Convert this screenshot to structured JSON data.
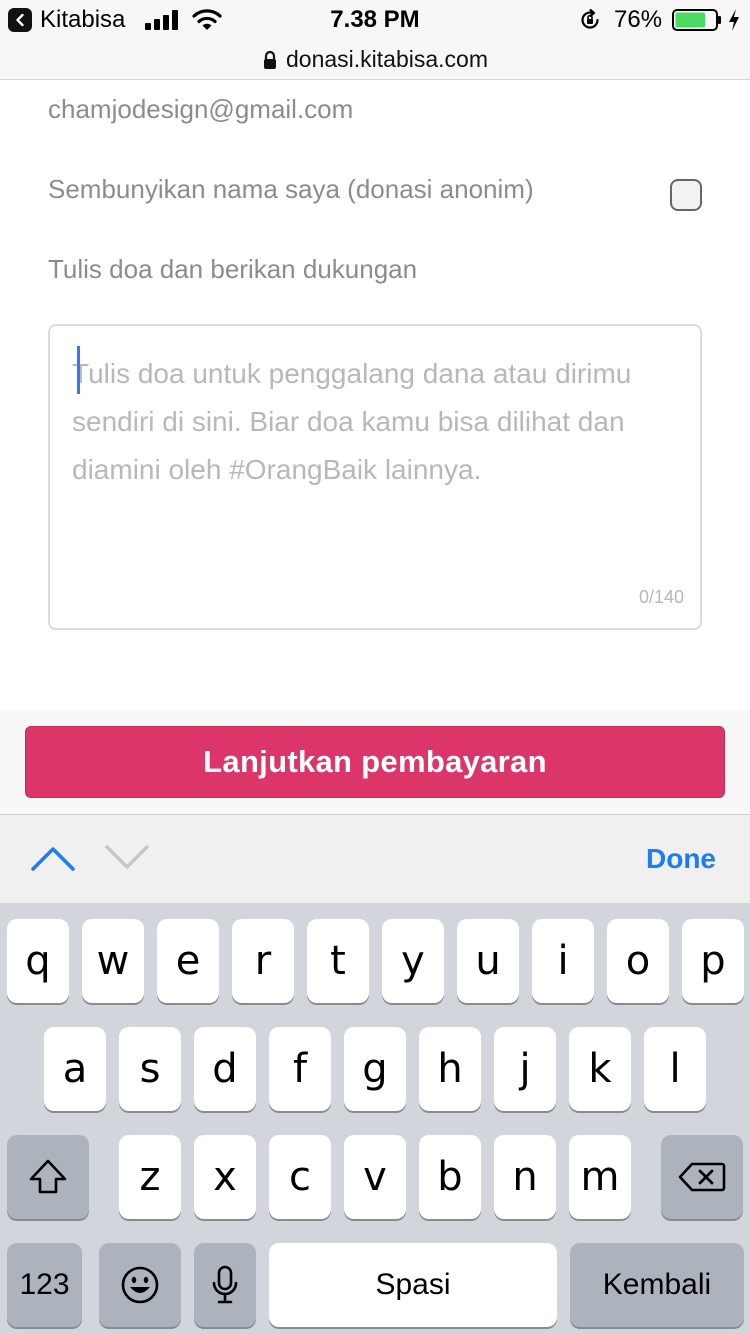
{
  "status_bar": {
    "back_app": "Kitabisa",
    "time": "7.38 PM",
    "battery_percent": "76%",
    "battery_level": 0.76
  },
  "url_bar": {
    "domain": "donasi.kitabisa.com"
  },
  "form": {
    "email": "chamjodesign@gmail.com",
    "anonymous_label": "Sembunyikan nama saya (donasi anonim)",
    "anonymous_checked": false,
    "prayer_label": "Tulis doa dan berikan dukungan",
    "prayer_placeholder": "Tulis doa untuk penggalang dana atau dirimu sendiri di sini. Biar doa kamu bisa dilihat dan diamini oleh #OrangBaik lainnya.",
    "char_counter": "0/140"
  },
  "cta": {
    "label": "Lanjutkan pembayaran",
    "color": "#dc3569"
  },
  "accessory": {
    "done_label": "Done",
    "accent": "#1b7cf4"
  },
  "keyboard": {
    "row1": [
      "q",
      "w",
      "e",
      "r",
      "t",
      "y",
      "u",
      "i",
      "o",
      "p"
    ],
    "row2": [
      "a",
      "s",
      "d",
      "f",
      "g",
      "h",
      "j",
      "k",
      "l"
    ],
    "row3": [
      "z",
      "x",
      "c",
      "v",
      "b",
      "n",
      "m"
    ],
    "numbers_label": "123",
    "space_label": "Spasi",
    "return_label": "Kembali",
    "icons": {
      "shift": "shift-icon",
      "delete": "backspace-icon",
      "emoji": "emoji-icon",
      "mic": "microphone-icon"
    }
  }
}
